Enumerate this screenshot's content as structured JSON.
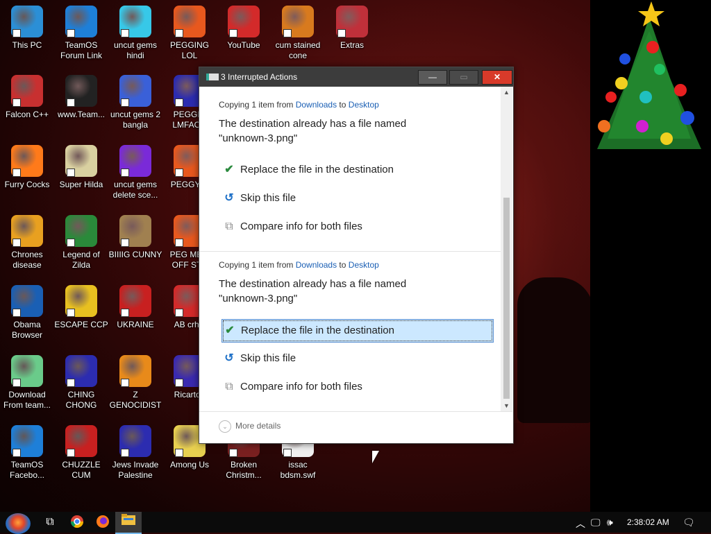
{
  "desktop_icons": [
    {
      "label": "This PC",
      "color": "#2b8fd6"
    },
    {
      "label": "TeamOS Forum Link",
      "color": "#1e7fd8"
    },
    {
      "label": "uncut gems hindi",
      "color": "#37c8e8"
    },
    {
      "label": "PEGGING LOL",
      "color": "#e8581e"
    },
    {
      "label": "YouTube",
      "color": "#d32a2a"
    },
    {
      "label": "cum stained cone",
      "color": "#d87a1e"
    },
    {
      "label": "Extras",
      "color": "#c0303a"
    },
    {
      "label": "Falcon C++",
      "color": "#c83030"
    },
    {
      "label": "www.Team...",
      "color": "#222222"
    },
    {
      "label": "uncut gems 2 bangla",
      "color": "#3a60d8"
    },
    {
      "label": "PEGGIN LMFAOC",
      "color": "#2c2cb0"
    },
    {
      "label": "Furry Cocks",
      "color": "#ff7a1a"
    },
    {
      "label": "Super Hilda",
      "color": "#d9d0a0"
    },
    {
      "label": "uncut gems delete sce...",
      "color": "#7a2ad8"
    },
    {
      "label": "PEGGY H",
      "color": "#e8581e"
    },
    {
      "label": "Chrones disease",
      "color": "#e8a020"
    },
    {
      "label": "Legend of Zilda",
      "color": "#2a8a3a"
    },
    {
      "label": "BIIIIG CUNNY",
      "color": "#a08050"
    },
    {
      "label": "PEG ME 2 OFF STE",
      "color": "#e8581e"
    },
    {
      "label": "Obama Browser",
      "color": "#1a5fb4"
    },
    {
      "label": "ESCAPE CCP",
      "color": "#e8c020"
    },
    {
      "label": "UKRAINE",
      "color": "#c82020"
    },
    {
      "label": "AB crhis",
      "color": "#d32a2a"
    },
    {
      "label": "Download From team...",
      "color": "#6acb8a"
    },
    {
      "label": "CHING CHONG",
      "color": "#2c2cb0"
    },
    {
      "label": "Z GENOCIDIST",
      "color": "#e88a1a"
    },
    {
      "label": "Ricartoo",
      "color": "#3a2ab0"
    },
    {
      "label": "TeamOS Facebo...",
      "color": "#1e7fd8"
    },
    {
      "label": "CHUZZLE CUM",
      "color": "#c82020"
    },
    {
      "label": "Jews Invade Palestine",
      "color": "#2c2cb0"
    },
    {
      "label": "Among Us",
      "color": "#e8d050"
    },
    {
      "label": "Broken Christm...",
      "color": "#7a2020"
    },
    {
      "label": "issac bdsm.swf",
      "color": "#f0f0f0"
    }
  ],
  "dialog": {
    "title": "3 Interrupted Actions",
    "conflicts": [
      {
        "head_prefix": "Copying 1 item from ",
        "from": "Downloads",
        "to_word": " to ",
        "to": "Desktop",
        "message": "The destination already has a file named \"unknown-3.png\"",
        "options": [
          {
            "label": "Replace the file in the destination",
            "icon": "check-icon"
          },
          {
            "label": "Skip this file",
            "icon": "skip-arrow-icon"
          },
          {
            "label": "Compare info for both files",
            "icon": "compare-icon"
          }
        ]
      },
      {
        "head_prefix": "Copying 1 item from ",
        "from": "Downloads",
        "to_word": " to ",
        "to": "Desktop",
        "message": "The destination already has a file named \"unknown-3.png\"",
        "options": [
          {
            "label": "Replace the file in the destination",
            "icon": "check-icon",
            "selected": true
          },
          {
            "label": "Skip this file",
            "icon": "skip-arrow-icon"
          },
          {
            "label": "Compare info for both files",
            "icon": "compare-icon"
          }
        ]
      }
    ],
    "more_details": "More details"
  },
  "taskbar": {
    "clock": "2:38:02 AM"
  },
  "colors": {
    "link": "#1a5fb4",
    "selection": "#cce8ff",
    "close_button": "#d83a2a"
  }
}
